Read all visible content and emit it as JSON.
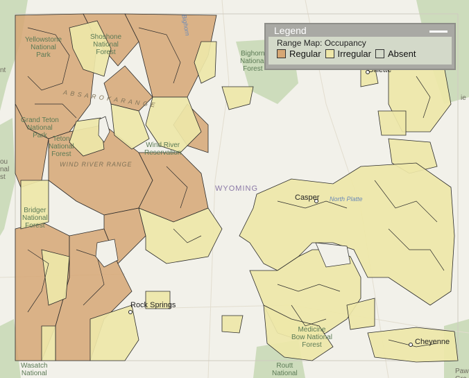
{
  "legend": {
    "title": "Legend",
    "subtitle": "Range Map: Occupancy",
    "items": [
      {
        "label": "Regular",
        "color": "#d6a775"
      },
      {
        "label": "Irregular",
        "color": "#eee7a8"
      },
      {
        "label": "Absent",
        "color": "#d3d9c9"
      }
    ]
  },
  "labels": {
    "state": "WYOMING",
    "cities": {
      "rock_springs": "Rock Springs",
      "casper": "Casper",
      "cheyenne": "Cheyenne",
      "gillette": "Gillette"
    },
    "parks": {
      "yellowstone": "Yellowstone\nNational\nPark",
      "shoshone": "Shoshone\nNational\nForest",
      "bighorn": "Bighorn\nNational\nForest",
      "grand_teton": "Grand Teton\nNational\nPark",
      "teton_forest": "Teton\nNational\nForest",
      "wind_river_res": "Wind River\nReservation",
      "bridger": "Bridger\nNational\nForest",
      "medicine_bow": "Medicine\nBow National\nForest",
      "wasatch": "Wasatch\nNational\nForest",
      "routt": "Routt\nNational\nForest"
    },
    "ranges": {
      "absaroka": "A B S A R O K A   R A N G E",
      "wind_river": "WIND RIVER RANGE"
    },
    "rivers": {
      "north_platte": "North Platte",
      "bighorn_river": "Bighorn"
    },
    "edge": {
      "left_top": "nt",
      "left_mid": "ou\nnal\nst",
      "right_top": "ie",
      "right_bottom": "Paw\nGra"
    }
  },
  "colors": {
    "background": "#f2f1ea",
    "forest": "#c7d8b4",
    "regular": "#d6a775",
    "irregular": "#eee7a8",
    "outline": "#2a2a2a"
  }
}
